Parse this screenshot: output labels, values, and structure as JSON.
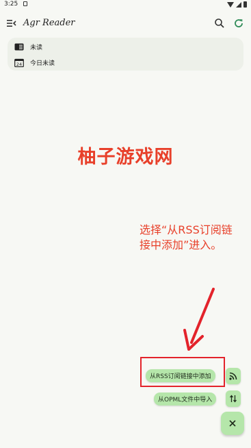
{
  "status_bar": {
    "time": "3:25"
  },
  "app_bar": {
    "title": "Agr Reader"
  },
  "filters": [
    {
      "label": "未读",
      "icon": "unread-icon"
    },
    {
      "label": "今日未读",
      "icon": "calendar-icon",
      "icon_text": "24"
    }
  ],
  "watermark": "柚子游戏网",
  "annotation": "选择“从RSS订阅链接中添加”进入。",
  "fab_menu": {
    "rss_label": "从RSS订阅链接中添加",
    "opml_label": "从OPML文件中导入"
  },
  "colors": {
    "accent": "#b5e6aa",
    "annotation": "#e8402a",
    "highlight": "#e3232b",
    "refresh": "#2e8b57"
  }
}
